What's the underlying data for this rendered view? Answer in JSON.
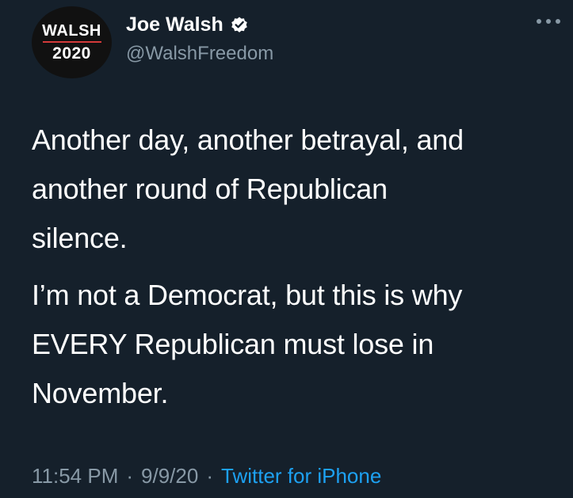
{
  "author": {
    "display_name": "Joe Walsh",
    "handle": "@WalshFreedom",
    "verified": true,
    "avatar_text_line1": "WALSH",
    "avatar_text_line2": "2020"
  },
  "tweet": {
    "paragraphs": [
      "Another day, another betrayal, and\nanother round of Republican\nsilence.",
      "I’m not a Democrat, but this is why\nEVERY Republican must lose in\nNovember."
    ],
    "time": "11:54 PM",
    "separator": "·",
    "date": "9/9/20",
    "source": "Twitter for iPhone"
  },
  "icons": {
    "verified": "verified-badge-icon",
    "more": "more-options-icon"
  },
  "colors": {
    "background": "#15202b",
    "text_primary": "#ffffff",
    "text_secondary": "#8899a6",
    "link": "#1da1f2",
    "verified_badge": "#ffffff",
    "avatar_accent": "#d43a3a"
  }
}
